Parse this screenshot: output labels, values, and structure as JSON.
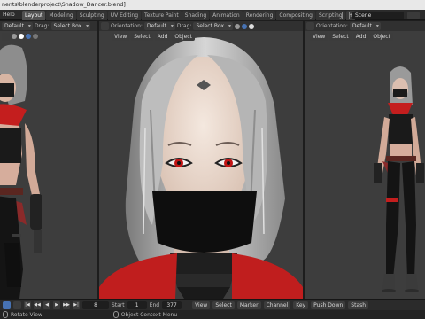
{
  "window": {
    "title": "nents\\blenderproject\\Shadow_Dancer.blend]"
  },
  "topbar": {
    "help": "Help",
    "tabs": [
      "Layout",
      "Modeling",
      "Sculpting",
      "UV Editing",
      "Texture Paint",
      "Shading",
      "Animation",
      "Rendering",
      "Compositing",
      "Scripting"
    ],
    "active_tab": "Layout",
    "add_tab": "+",
    "scene": "Scene"
  },
  "viewport_left": {
    "orientation_value": "Default",
    "drag_label": "Drag:",
    "drag_value": "Select Box"
  },
  "viewport_mid": {
    "orientation_label": "Orientation:",
    "orientation_value": "Default",
    "drag_label": "Drag:",
    "drag_value": "Select Box",
    "menus": [
      "View",
      "Select",
      "Add",
      "Object"
    ]
  },
  "viewport_right": {
    "orientation_label": "Orientation:",
    "orientation_value": "Default",
    "menus": [
      "View",
      "Select",
      "Add",
      "Object"
    ]
  },
  "timeline": {
    "current_frame": "8",
    "start_label": "Start",
    "start_value": "1",
    "end_label": "End",
    "end_value": "377",
    "menus": [
      "View",
      "Select",
      "Marker",
      "Channel",
      "Key"
    ],
    "push_down": "Push Down",
    "stash": "Stash"
  },
  "statusbar": {
    "left": "Rotate View",
    "middle": "Object Context Menu"
  },
  "colors": {
    "accent": "#4772b3",
    "viewport_bg": "#3d3d3d",
    "header_bg": "#303030"
  }
}
